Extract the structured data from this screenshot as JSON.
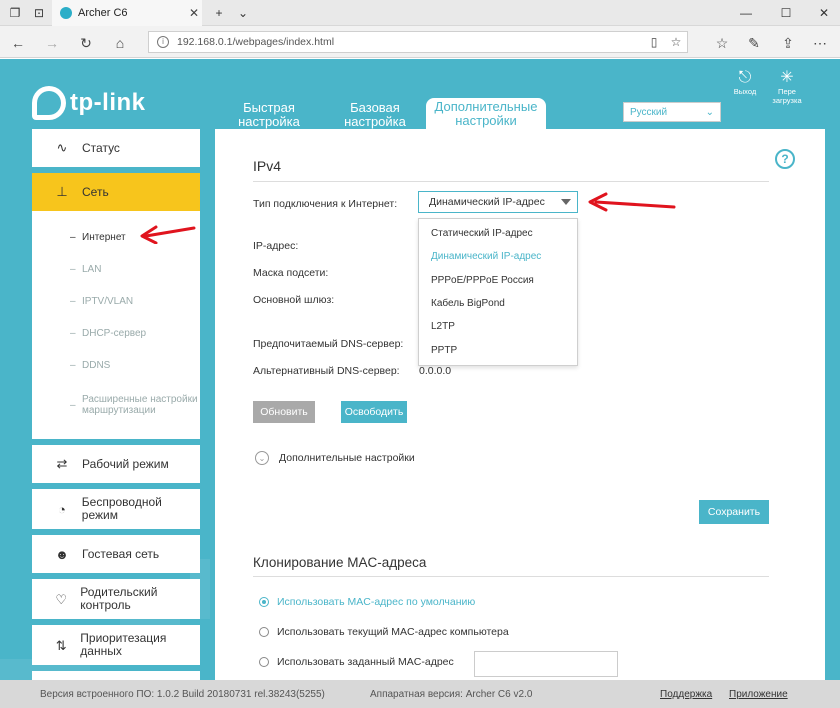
{
  "browser": {
    "tab_title": "Archer C6",
    "url": "192.168.0.1/webpages/index.html"
  },
  "header": {
    "brand": "tp-link",
    "tabs": [
      {
        "label": "Быстрая настройка"
      },
      {
        "label": "Базовая настройка"
      },
      {
        "label": "Дополнительные настройки"
      }
    ],
    "language": "Русский",
    "logout_label": "Выход",
    "reboot_label": "Пере загрузка"
  },
  "sidebar": {
    "items": [
      {
        "label": "Статус",
        "icon": "pulse-icon"
      },
      {
        "label": "Сеть",
        "icon": "network-icon"
      },
      {
        "label": "Рабочий режим",
        "icon": "swap-icon"
      },
      {
        "label": "Беспроводной режим",
        "icon": "wifi-icon"
      },
      {
        "label": "Гостевая сеть",
        "icon": "guests-icon"
      },
      {
        "label": "Родительский контроль",
        "icon": "heart-icon"
      },
      {
        "label": "Приоритезация данных",
        "icon": "updown-icon"
      }
    ],
    "network_submenu": [
      "Интернет",
      "LAN",
      "IPTV/VLAN",
      "DHCP-сервер",
      "DDNS",
      "Расширенные настройки маршрутизации"
    ]
  },
  "main": {
    "ipv4_title": "IPv4",
    "conn_type_label": "Тип подключения к Интернет:",
    "conn_type_value": "Динамический IP-адрес",
    "conn_type_options": [
      "Статический IP-адрес",
      "Динамический IP-адрес",
      "PPPoE/PPPoE Россия",
      "Кабель BigPond",
      "L2TP",
      "PPTP"
    ],
    "ip_label": "IP-адрес:",
    "mask_label": "Маска подсети:",
    "gateway_label": "Основной шлюз:",
    "dns1_label": "Предпочитаемый DNS-сервер:",
    "dns2_label": "Альтернативный DNS-сервер:",
    "dns2_value": "0.0.0.0",
    "renew_label": "Обновить",
    "release_label": "Освободить",
    "advanced_label": "Дополнительные настройки",
    "save_label": "Сохранить",
    "mac_title": "Клонирование MAC-адреса",
    "mac_options": [
      "Использовать MAC-адрес по умолчанию",
      "Использовать текущий MAC-адрес компьютера",
      "Использовать заданный MAC-адрес"
    ]
  },
  "footer": {
    "firmware": "Версия встроенного ПО: 1.0.2 Build 20180731 rel.38243(5255)",
    "hardware": "Аппаратная версия: Archer C6 v2.0",
    "support": "Поддержка",
    "app": "Приложение"
  },
  "colors": {
    "accent": "#4ab5c9",
    "active_menu": "#f7c51c",
    "annotation_arrow": "#e0141e"
  }
}
